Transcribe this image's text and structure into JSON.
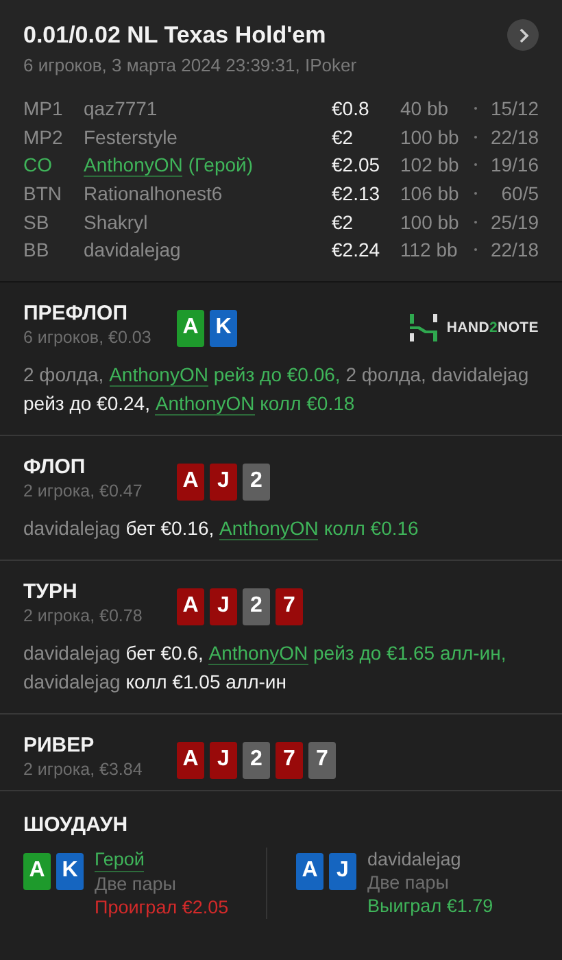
{
  "header": {
    "title": "0.01/0.02 NL Texas Hold'em",
    "subtitle": "6 игроков, 3 марта 2024 23:39:31, IPoker"
  },
  "players": [
    {
      "position": "MP1",
      "name": "qaz7771",
      "hero": false,
      "stack": "€0.8",
      "bb": "40 bb",
      "stats": "15/12"
    },
    {
      "position": "MP2",
      "name": "Festerstyle",
      "hero": false,
      "stack": "€2",
      "bb": "100 bb",
      "stats": "22/18"
    },
    {
      "position": "CO",
      "name": "AnthonyON",
      "suffix": "(Герой)",
      "hero": true,
      "stack": "€2.05",
      "bb": "102 bb",
      "stats": "19/16"
    },
    {
      "position": "BTN",
      "name": "Rationalhonest6",
      "hero": false,
      "stack": "€2.13",
      "bb": "106 bb",
      "stats": "60/5"
    },
    {
      "position": "SB",
      "name": "Shakryl",
      "hero": false,
      "stack": "€2",
      "bb": "100 bb",
      "stats": "25/19"
    },
    {
      "position": "BB",
      "name": "davidalejag",
      "hero": false,
      "stack": "€2.24",
      "bb": "112 bb",
      "stats": "22/18"
    }
  ],
  "streets": [
    {
      "title": "ПРЕФЛОП",
      "info": "6 игроков, €0.03",
      "cards": [
        {
          "rank": "A",
          "color": "#1e9a2c"
        },
        {
          "rank": "K",
          "color": "#1565c0"
        }
      ],
      "logo": {
        "prefix": "HAND",
        "accent": "2",
        "suffix": "NOTE"
      },
      "actions": [
        {
          "kind": "muted",
          "text": "2 фолда,"
        },
        {
          "kind": "hero",
          "text": "AnthonyON"
        },
        {
          "kind": "hero_text",
          "text": "рейз до €0.06,"
        },
        {
          "kind": "muted",
          "text": "2 фолда,"
        },
        {
          "kind": "muted",
          "text": "davidalejag"
        },
        {
          "kind": "action",
          "text": "рейз до €0.24,"
        },
        {
          "kind": "hero",
          "text": "AnthonyON"
        },
        {
          "kind": "hero_text",
          "text": "колл €0.18"
        }
      ]
    },
    {
      "title": "ФЛОП",
      "info": "2 игрока, €0.47",
      "cards": [
        {
          "rank": "A",
          "color": "#990a0a"
        },
        {
          "rank": "J",
          "color": "#990a0a"
        },
        {
          "rank": "2",
          "color": "#5f5f5f"
        }
      ],
      "actions": [
        {
          "kind": "muted",
          "text": "davidalejag"
        },
        {
          "kind": "action",
          "text": "бет €0.16,"
        },
        {
          "kind": "hero",
          "text": "AnthonyON"
        },
        {
          "kind": "hero_text",
          "text": "колл €0.16"
        }
      ]
    },
    {
      "title": "ТУРН",
      "info": "2 игрока, €0.78",
      "cards": [
        {
          "rank": "A",
          "color": "#990a0a"
        },
        {
          "rank": "J",
          "color": "#990a0a"
        },
        {
          "rank": "2",
          "color": "#5f5f5f"
        },
        {
          "rank": "7",
          "color": "#990a0a"
        }
      ],
      "actions": [
        {
          "kind": "muted",
          "text": "davidalejag"
        },
        {
          "kind": "action",
          "text": "бет €0.6,"
        },
        {
          "kind": "hero",
          "text": "AnthonyON"
        },
        {
          "kind": "hero_text",
          "text": "рейз до €1.65 алл-ин,"
        },
        {
          "kind": "muted",
          "text": "davidalejag"
        },
        {
          "kind": "action",
          "text": "колл €1.05 алл-ин"
        }
      ]
    },
    {
      "title": "РИВЕР",
      "info": "2 игрока, €3.84",
      "cards": [
        {
          "rank": "A",
          "color": "#990a0a"
        },
        {
          "rank": "J",
          "color": "#990a0a"
        },
        {
          "rank": "2",
          "color": "#5f5f5f"
        },
        {
          "rank": "7",
          "color": "#990a0a"
        },
        {
          "rank": "7",
          "color": "#5f5f5f"
        }
      ]
    }
  ],
  "showdown": {
    "title": "ШОУДАУН",
    "players": [
      {
        "name": "Герой",
        "hero": true,
        "cards": [
          {
            "rank": "A",
            "color": "#1e9a2c"
          },
          {
            "rank": "K",
            "color": "#1565c0"
          }
        ],
        "hand": "Две пары",
        "result": "Проиграл €2.05",
        "won": false
      },
      {
        "name": "davidalejag",
        "hero": false,
        "cards": [
          {
            "rank": "A",
            "color": "#1565c0"
          },
          {
            "rank": "J",
            "color": "#1565c0"
          }
        ],
        "hand": "Две пары",
        "result": "Выиграл €1.79",
        "won": true
      }
    ]
  }
}
